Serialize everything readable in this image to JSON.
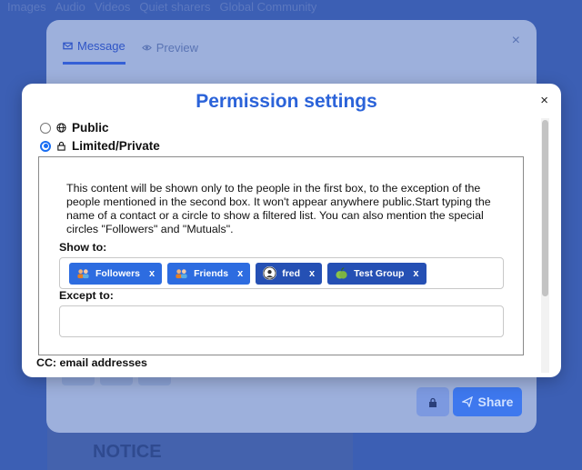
{
  "background": {
    "nav_items": [
      "Images",
      "Audio",
      "Videos",
      "Quiet sharers",
      "Global Community"
    ],
    "art_text": "NOTICE",
    "tabs": [
      {
        "label": "Message",
        "active": true,
        "icon": "envelope-icon"
      },
      {
        "label": "Preview",
        "active": false,
        "icon": "eye-icon"
      }
    ],
    "close_glyph": "×",
    "share_label": "Share"
  },
  "dialog": {
    "title": "Permission settings",
    "close_glyph": "×",
    "options": [
      {
        "label": "Public",
        "checked": false,
        "icon": "globe-icon"
      },
      {
        "label": "Limited/Private",
        "checked": true,
        "icon": "lock-icon"
      }
    ],
    "info_text": "This content will be shown only to the people in the first box, to the exception of the people mentioned in the second box. It won't appear anywhere public.Start typing the name of a contact or a circle to show a filtered list. You can also mention the special circles \"Followers\" and \"Mutuals\".",
    "show_to_label": "Show to:",
    "show_to_tags": [
      {
        "label": "Followers",
        "remove": "x",
        "color": "#2d6ce0",
        "icon": "group-icon"
      },
      {
        "label": "Friends",
        "remove": "x",
        "color": "#2d6ce0",
        "icon": "group-icon"
      },
      {
        "label": "fred",
        "remove": "x",
        "color": "#2550b4",
        "icon": "user-avatar-icon"
      },
      {
        "label": "Test Group",
        "remove": "x",
        "color": "#2550b4",
        "icon": "apple-icon"
      }
    ],
    "except_to_label": "Except to:",
    "except_to_value": "",
    "cc_label": "CC: email addresses"
  }
}
